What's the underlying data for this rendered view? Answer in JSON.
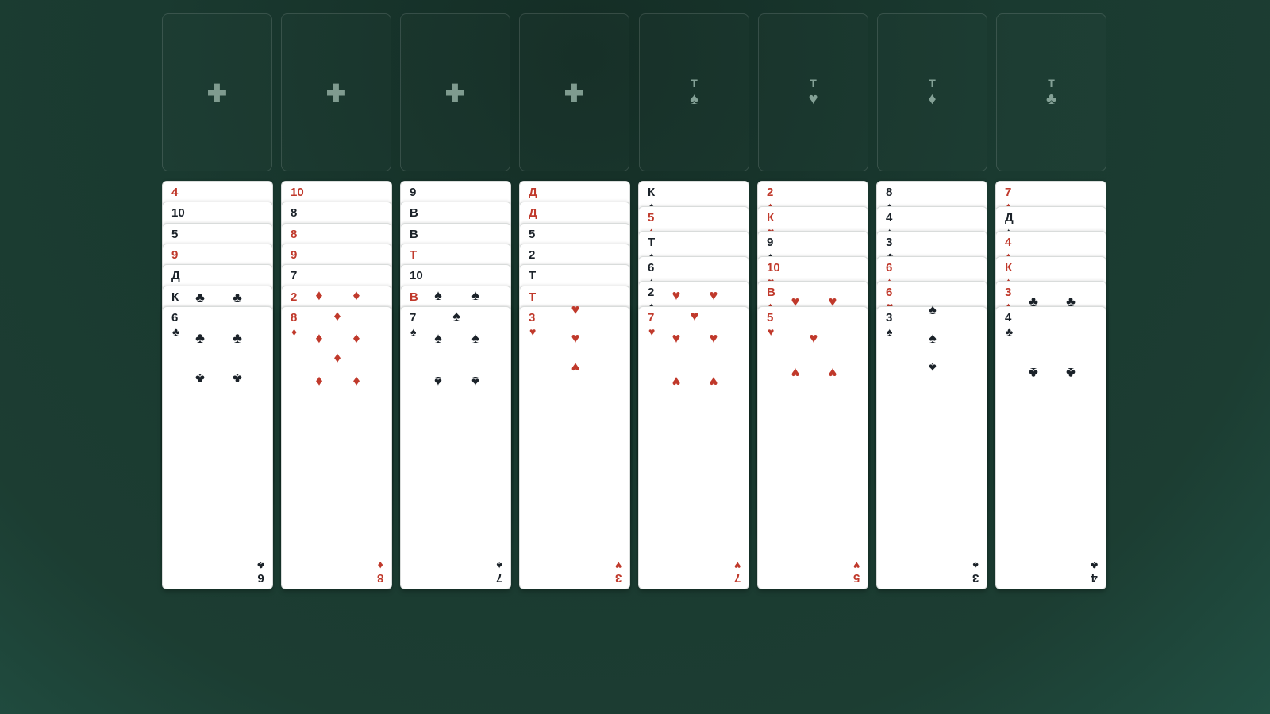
{
  "foundation_slots": [
    {
      "type": "empty",
      "glyph": "✚"
    },
    {
      "type": "empty",
      "glyph": "✚"
    },
    {
      "type": "empty",
      "glyph": "✚"
    },
    {
      "type": "empty",
      "glyph": "✚"
    },
    {
      "type": "ace",
      "rank": "Т",
      "suit": "♠"
    },
    {
      "type": "ace",
      "rank": "Т",
      "suit": "♥"
    },
    {
      "type": "ace",
      "rank": "Т",
      "suit": "♦"
    },
    {
      "type": "ace",
      "rank": "Т",
      "suit": "♣"
    }
  ],
  "columns": [
    {
      "cards": [
        {
          "rank": "4",
          "suit": "♦",
          "color": "red"
        },
        {
          "rank": "10",
          "suit": "♠",
          "color": "black"
        },
        {
          "rank": "5",
          "suit": "♣",
          "color": "black"
        },
        {
          "rank": "9",
          "suit": "♦",
          "color": "red"
        },
        {
          "rank": "Д",
          "suit": "♣",
          "color": "black"
        },
        {
          "rank": "К",
          "suit": "♣",
          "color": "black"
        },
        {
          "rank": "6",
          "suit": "♣",
          "color": "black"
        }
      ]
    },
    {
      "cards": [
        {
          "rank": "10",
          "suit": "♦",
          "color": "red"
        },
        {
          "rank": "8",
          "suit": "♣",
          "color": "black"
        },
        {
          "rank": "8",
          "suit": "♥",
          "color": "red"
        },
        {
          "rank": "9",
          "suit": "♥",
          "color": "red"
        },
        {
          "rank": "7",
          "suit": "♣",
          "color": "black"
        },
        {
          "rank": "2",
          "suit": "♦",
          "color": "red"
        },
        {
          "rank": "8",
          "suit": "♦",
          "color": "red"
        }
      ]
    },
    {
      "cards": [
        {
          "rank": "9",
          "suit": "♣",
          "color": "black"
        },
        {
          "rank": "В",
          "suit": "♣",
          "color": "black"
        },
        {
          "rank": "В",
          "suit": "♠",
          "color": "black"
        },
        {
          "rank": "Т",
          "suit": "♥",
          "color": "red"
        },
        {
          "rank": "10",
          "suit": "♣",
          "color": "black"
        },
        {
          "rank": "В",
          "suit": "♥",
          "color": "red"
        },
        {
          "rank": "7",
          "suit": "♠",
          "color": "black"
        }
      ]
    },
    {
      "cards": [
        {
          "rank": "Д",
          "suit": "♦",
          "color": "red"
        },
        {
          "rank": "Д",
          "suit": "♥",
          "color": "red"
        },
        {
          "rank": "5",
          "suit": "♠",
          "color": "black"
        },
        {
          "rank": "2",
          "suit": "♣",
          "color": "black"
        },
        {
          "rank": "Т",
          "suit": "♣",
          "color": "black"
        },
        {
          "rank": "Т",
          "suit": "♦",
          "color": "red"
        },
        {
          "rank": "3",
          "suit": "♥",
          "color": "red"
        }
      ]
    },
    {
      "cards": [
        {
          "rank": "К",
          "suit": "♠",
          "color": "black"
        },
        {
          "rank": "5",
          "suit": "♦",
          "color": "red"
        },
        {
          "rank": "Т",
          "suit": "♠",
          "color": "black"
        },
        {
          "rank": "6",
          "suit": "♠",
          "color": "black"
        },
        {
          "rank": "2",
          "suit": "♠",
          "color": "black"
        },
        {
          "rank": "7",
          "suit": "♥",
          "color": "red"
        }
      ]
    },
    {
      "cards": [
        {
          "rank": "2",
          "suit": "♦",
          "color": "red"
        },
        {
          "rank": "К",
          "suit": "♥",
          "color": "red"
        },
        {
          "rank": "9",
          "suit": "♠",
          "color": "black"
        },
        {
          "rank": "10",
          "suit": "♥",
          "color": "red"
        },
        {
          "rank": "В",
          "suit": "♦",
          "color": "red"
        },
        {
          "rank": "5",
          "suit": "♥",
          "color": "red"
        }
      ]
    },
    {
      "cards": [
        {
          "rank": "8",
          "suit": "♠",
          "color": "black"
        },
        {
          "rank": "4",
          "suit": "♠",
          "color": "black"
        },
        {
          "rank": "3",
          "suit": "♣",
          "color": "black"
        },
        {
          "rank": "6",
          "suit": "♦",
          "color": "red"
        },
        {
          "rank": "6",
          "suit": "♥",
          "color": "red"
        },
        {
          "rank": "3",
          "suit": "♠",
          "color": "black"
        }
      ]
    },
    {
      "cards": [
        {
          "rank": "7",
          "suit": "♦",
          "color": "red"
        },
        {
          "rank": "Д",
          "suit": "♠",
          "color": "black"
        },
        {
          "rank": "4",
          "suit": "♦",
          "color": "red"
        },
        {
          "rank": "К",
          "suit": "♦",
          "color": "red"
        },
        {
          "rank": "3",
          "suit": "♦",
          "color": "red"
        },
        {
          "rank": "4",
          "suit": "♣",
          "color": "black"
        }
      ]
    }
  ],
  "colors": {
    "felt": "#1c3d32",
    "red_suit": "#c0392b",
    "black_suit": "#1b2229",
    "slot_glyph": "#84a196"
  }
}
